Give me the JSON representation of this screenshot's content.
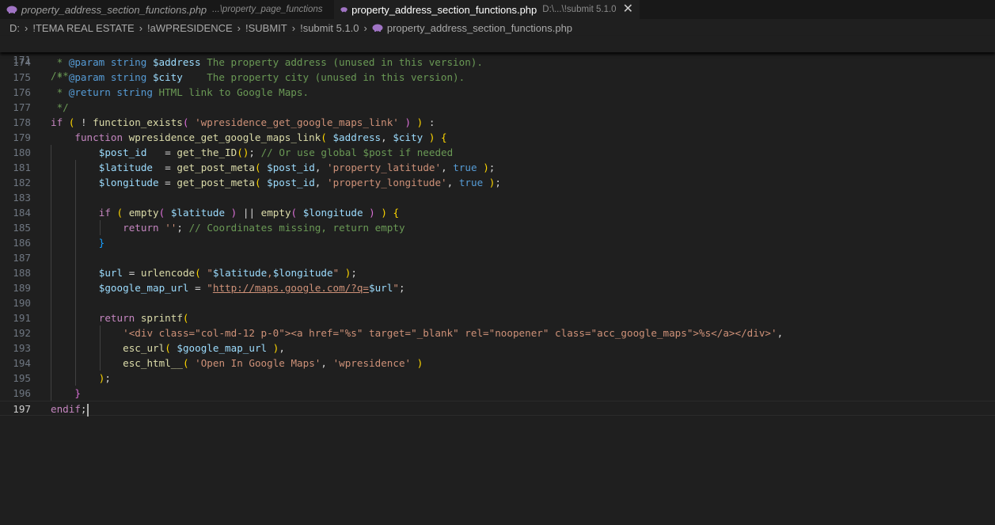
{
  "tabs": [
    {
      "name": "property_address_section_functions.php",
      "path": "...\\property_page_functions",
      "active": false
    },
    {
      "name": "property_address_section_functions.php",
      "path": "D:\\...\\!submit 5.1.0",
      "active": true,
      "close": "✕"
    }
  ],
  "breadcrumb": {
    "items": [
      "D:",
      "!TEMA REAL ESTATE",
      "!aWPRESIDENCE",
      "!SUBMIT",
      "!submit 5.1.0"
    ],
    "file": "property_address_section_functions.php",
    "separator": "›"
  },
  "editor": {
    "language": "php",
    "sticky_line": {
      "number": "171",
      "text": "/**"
    },
    "current_line": "197",
    "line_numbers": [
      "174",
      "175",
      "176",
      "177",
      "178",
      "179",
      "180",
      "181",
      "182",
      "183",
      "184",
      "185",
      "186",
      "187",
      "188",
      "189",
      "190",
      "191",
      "192",
      "193",
      "194",
      "195",
      "196",
      "197"
    ],
    "lines": [
      " * @param string $address The property address (unused in this version).",
      " * @param string $city    The property city (unused in this version).",
      " * @return string HTML link to Google Maps.",
      " */",
      "if ( ! function_exists( 'wpresidence_get_google_maps_link' ) ) :",
      "    function wpresidence_get_google_maps_link( $address, $city ) {",
      "        $post_id   = get_the_ID(); // Or use global $post if needed",
      "        $latitude  = get_post_meta( $post_id, 'property_latitude', true );",
      "        $longitude = get_post_meta( $post_id, 'property_longitude', true );",
      "",
      "        if ( empty( $latitude ) || empty( $longitude ) ) {",
      "            return ''; // Coordinates missing, return empty",
      "        }",
      "",
      "        $url = urlencode( \"$latitude,$longitude\" );",
      "        $google_map_url = \"http://maps.google.com/?q=$url\";",
      "",
      "        return sprintf(",
      "            '<div class=\"col-md-12 p-0\"><a href=\"%s\" target=\"_blank\" rel=\"noopener\" class=\"acc_google_maps\">%s</a></div>',",
      "            esc_url( $google_map_url ),",
      "            esc_html__( 'Open In Google Maps', 'wpresidence' )",
      "        );",
      "    }",
      "endif;"
    ]
  },
  "colors": {
    "background": "#1f1f1f",
    "comment": "#6a9955",
    "keyword": "#c586c0",
    "type": "#569cd6",
    "function": "#dcdcaa",
    "variable": "#9cdcfe",
    "string": "#ce9178",
    "bracket_1": "#ffd700",
    "bracket_2": "#da70d6",
    "bracket_3": "#179fff",
    "php_icon": "#a074c4"
  }
}
